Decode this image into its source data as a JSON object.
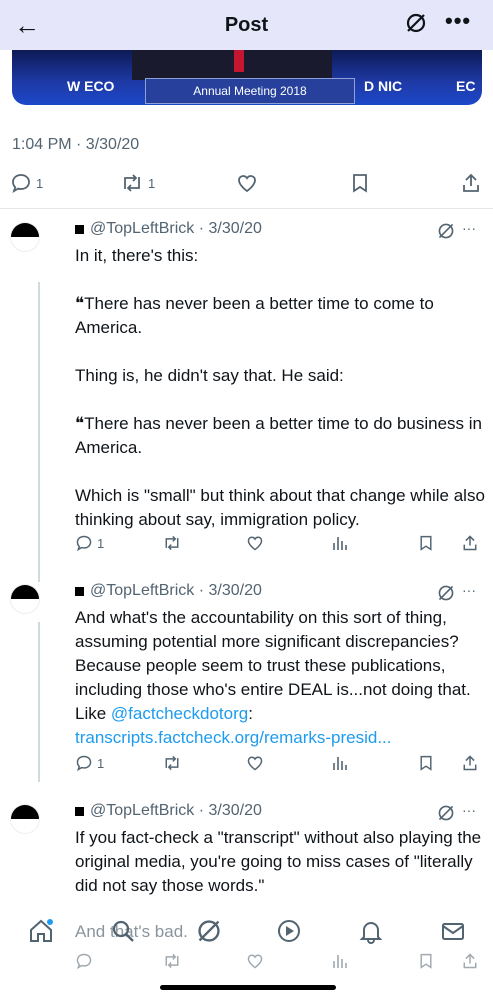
{
  "header": {
    "back_icon": "arrow-left-icon",
    "title": "Post",
    "grok_icon": "grok-icon",
    "more_icon": "more-icon",
    "more_label": "•••"
  },
  "media": {
    "podium_text": "Annual Meeting 2018",
    "left_logo": "W ECO",
    "right_logo": "D NIC",
    "far_right": "EC"
  },
  "post": {
    "timestamp": "1:04 PM · 3/30/20",
    "reply_count": "1",
    "repost_count": "1"
  },
  "replies": [
    {
      "handle": "@TopLeftBrick",
      "date": "3/30/20",
      "paragraphs": [
        "In it, there's this:",
        "❝There has never been a better time to come to America.",
        "Thing is, he didn't say that. He said:",
        "❝There has never been a better time to do business in America.",
        "Which is \"small\" but think about that change while also thinking about say, immigration policy."
      ],
      "reply_count": "1"
    },
    {
      "handle": "@TopLeftBrick",
      "date": "3/30/20",
      "text": "And what's the accountability on this sort of thing, assuming potential more significant discrepancies? Because people seem to trust these publications, including those who's entire DEAL is...not doing that. Like ",
      "mention": "@factcheckdotorg",
      "after_mention": ":",
      "link": "transcripts.factcheck.org/remarks-presid...",
      "reply_count": "1"
    },
    {
      "handle": "@TopLeftBrick",
      "date": "3/30/20",
      "text": "If you fact-check a \"transcript\" without also playing the original media, you're going to miss cases of \"literally did not say those words.\"",
      "cutoff_text": "And that's bad."
    }
  ],
  "more_label": "···",
  "tabbar": {
    "items": [
      "home-icon",
      "search-icon",
      "grok-icon",
      "play-icon",
      "bell-icon",
      "mail-icon"
    ]
  }
}
